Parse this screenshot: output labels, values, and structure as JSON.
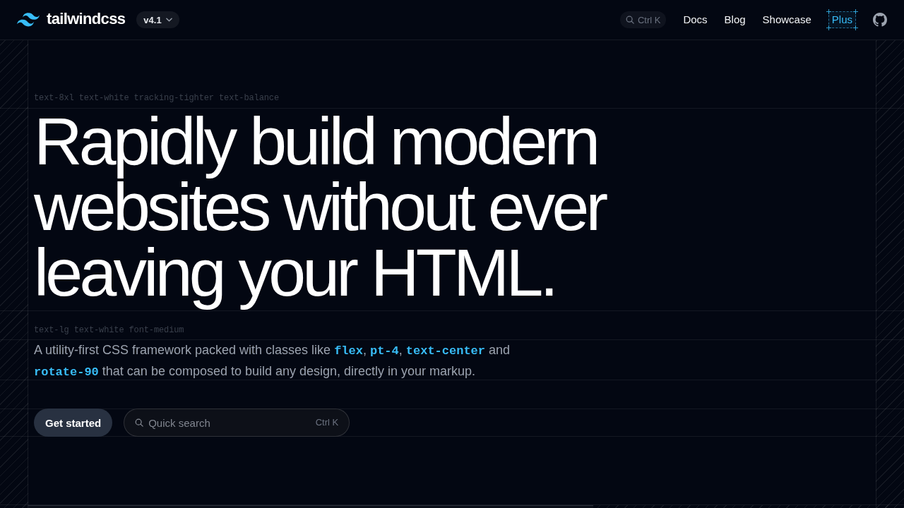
{
  "header": {
    "brand": "tailwindcss",
    "version": "v4.1",
    "search_shortcut": "Ctrl K",
    "nav": [
      {
        "label": "Docs",
        "kind": "link"
      },
      {
        "label": "Blog",
        "kind": "link"
      },
      {
        "label": "Showcase",
        "kind": "link"
      },
      {
        "label": "Plus",
        "kind": "featured"
      }
    ]
  },
  "hero": {
    "title_classes": "text-8xl text-white tracking-tighter text-balance",
    "title": "Rapidly build modern websites without ever leaving your HTML.",
    "description_classes": "text-lg text-white font-medium",
    "description": [
      {
        "kind": "text",
        "text": "A utility-first CSS framework packed with classes like "
      },
      {
        "kind": "code",
        "text": "flex"
      },
      {
        "kind": "text",
        "text": ", "
      },
      {
        "kind": "code",
        "text": "pt-4"
      },
      {
        "kind": "text",
        "text": ", "
      },
      {
        "kind": "code",
        "text": "text-center"
      },
      {
        "kind": "text",
        "text": " and "
      },
      {
        "kind": "code",
        "text": "rotate-90"
      },
      {
        "kind": "text",
        "text": " that can be composed to build any design, directly in your markup."
      }
    ],
    "cta": "Get started",
    "search": {
      "placeholder": "Quick search",
      "shortcut": "Ctrl K"
    }
  }
}
